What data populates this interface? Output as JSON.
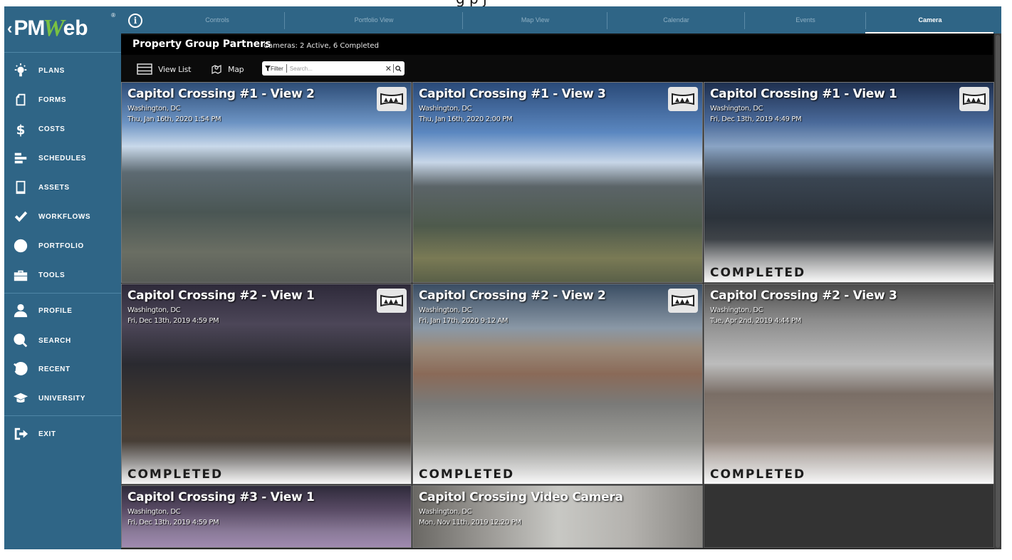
{
  "caption_partial": "g      p   j",
  "sidebar": {
    "logo": {
      "prefix": "‹",
      "pm": "PM",
      "w": "W",
      "eb": "eb",
      "reg": "®"
    },
    "items": [
      {
        "label": "PLANS",
        "icon": "lightbulb-icon"
      },
      {
        "label": "FORMS",
        "icon": "document-icon"
      },
      {
        "label": "COSTS",
        "icon": "dollar-icon"
      },
      {
        "label": "SCHEDULES",
        "icon": "schedule-bars-icon"
      },
      {
        "label": "ASSETS",
        "icon": "building-icon"
      },
      {
        "label": "WORKFLOWS",
        "icon": "checkmark-icon"
      },
      {
        "label": "PORTFOLIO",
        "icon": "globe-icon"
      },
      {
        "label": "TOOLS",
        "icon": "toolbox-icon"
      }
    ],
    "items2": [
      {
        "label": "PROFILE",
        "icon": "user-icon"
      },
      {
        "label": "SEARCH",
        "icon": "search-icon"
      },
      {
        "label": "RECENT",
        "icon": "history-icon"
      },
      {
        "label": "UNIVERSITY",
        "icon": "graduation-cap-icon"
      }
    ],
    "exit": {
      "label": "EXIT",
      "icon": "exit-icon"
    }
  },
  "tabs": {
    "info_icon": "i",
    "items": [
      {
        "label": "Controls",
        "active": false
      },
      {
        "label": "Portfolio View",
        "active": false
      },
      {
        "label": "Map View",
        "active": false
      },
      {
        "label": "Calendar",
        "active": false
      },
      {
        "label": "Events",
        "active": false
      },
      {
        "label": "Camera",
        "active": true
      }
    ]
  },
  "header": {
    "org": "Property Group Partners",
    "cameras_summary": "Cameras: 2 Active, 6 Completed"
  },
  "toolbar": {
    "view_list": "View List",
    "map": "Map",
    "filter_label": "Filter",
    "search_placeholder": "Search...",
    "search_value": "",
    "clear": "✕"
  },
  "cameras": [
    {
      "title": "Capitol Crossing #1 - View 2",
      "location": "Washington, DC",
      "date": "Thu, Jan 16th, 2020 1:54 PM",
      "status": "",
      "panorama": true
    },
    {
      "title": "Capitol Crossing #1 - View 3",
      "location": "Washington, DC",
      "date": "Thu, Jan 16th, 2020 2:00 PM",
      "status": "",
      "panorama": true
    },
    {
      "title": "Capitol Crossing #1 - View 1",
      "location": "Washington, DC",
      "date": "Fri, Dec 13th, 2019 4:49 PM",
      "status": "COMPLETED",
      "panorama": true
    },
    {
      "title": "Capitol Crossing #2 - View 1",
      "location": "Washington, DC",
      "date": "Fri, Dec 13th, 2019 4:59 PM",
      "status": "COMPLETED",
      "panorama": true
    },
    {
      "title": "Capitol Crossing #2 - View 2",
      "location": "Washington, DC",
      "date": "Fri, Jan 17th, 2020 9:12 AM",
      "status": "COMPLETED",
      "panorama": true
    },
    {
      "title": "Capitol Crossing #2 - View 3",
      "location": "Washington, DC",
      "date": "Tue, Apr 2nd, 2019 4:44 PM",
      "status": "COMPLETED",
      "panorama": false
    },
    {
      "title": "Capitol Crossing #3 - View 1",
      "location": "Washington, DC",
      "date": "Fri, Dec 13th, 2019 4:59 PM",
      "status": "",
      "panorama": false
    },
    {
      "title": "Capitol Crossing Video Camera",
      "location": "Washington, DC",
      "date": "Mon, Nov 11th, 2019 12:20 PM",
      "status": "",
      "panorama": false
    }
  ],
  "colors": {
    "sidebar_bg": "#2f6586",
    "logo_accent": "#7ac142",
    "content_bg": "#000000",
    "tile_empty": "#333333"
  }
}
